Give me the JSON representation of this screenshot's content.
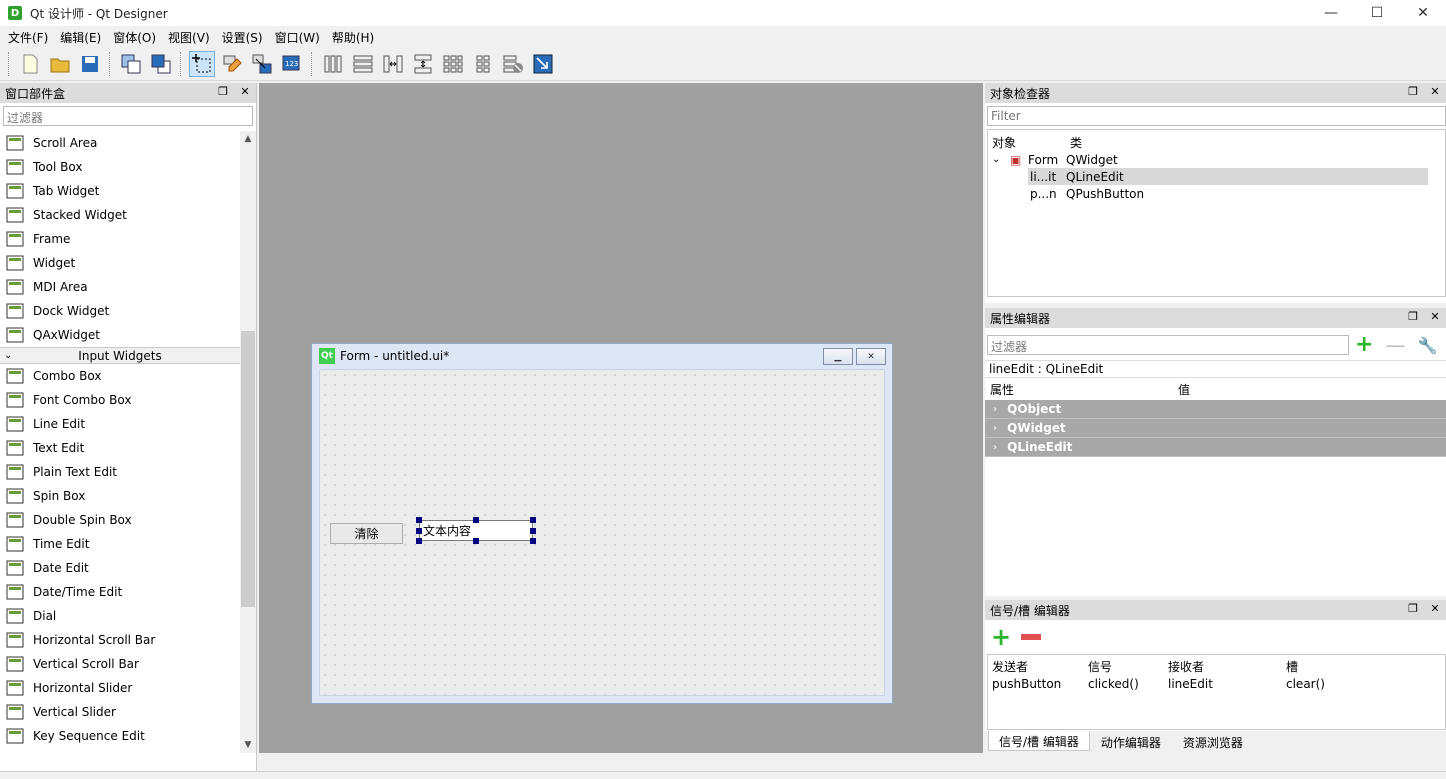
{
  "window": {
    "title": "Qt 设计师 - Qt Designer",
    "icon_letter": "D",
    "minimize": "—",
    "maximize": "☐",
    "close": "✕"
  },
  "menubar": [
    "文件(F)",
    "编辑(E)",
    "窗体(O)",
    "视图(V)",
    "设置(S)",
    "窗口(W)",
    "帮助(H)"
  ],
  "widgetbox": {
    "title": "窗口部件盒",
    "filter_placeholder": "过滤器",
    "items_top": [
      {
        "label": "Scroll Area",
        "icon": "scroll-area-icon"
      },
      {
        "label": "Tool Box",
        "icon": "tool-box-icon"
      },
      {
        "label": "Tab Widget",
        "icon": "tab-widget-icon"
      },
      {
        "label": "Stacked Widget",
        "icon": "stacked-widget-icon"
      },
      {
        "label": "Frame",
        "icon": "frame-icon"
      },
      {
        "label": "Widget",
        "icon": "widget-icon"
      },
      {
        "label": "MDI Area",
        "icon": "mdi-area-icon"
      },
      {
        "label": "Dock Widget",
        "icon": "dock-widget-icon"
      },
      {
        "label": "QAxWidget",
        "icon": "qaxwidget-icon"
      }
    ],
    "category": "Input Widgets",
    "items_input": [
      {
        "label": "Combo Box",
        "icon": "combo-box-icon"
      },
      {
        "label": "Font Combo Box",
        "icon": "font-combo-box-icon"
      },
      {
        "label": "Line Edit",
        "icon": "line-edit-icon"
      },
      {
        "label": "Text Edit",
        "icon": "text-edit-icon"
      },
      {
        "label": "Plain Text Edit",
        "icon": "plain-text-edit-icon"
      },
      {
        "label": "Spin Box",
        "icon": "spin-box-icon"
      },
      {
        "label": "Double Spin Box",
        "icon": "double-spin-box-icon"
      },
      {
        "label": "Time Edit",
        "icon": "time-edit-icon"
      },
      {
        "label": "Date Edit",
        "icon": "date-edit-icon"
      },
      {
        "label": "Date/Time Edit",
        "icon": "date-time-edit-icon"
      },
      {
        "label": "Dial",
        "icon": "dial-icon"
      },
      {
        "label": "Horizontal Scroll Bar",
        "icon": "horizontal-scroll-bar-icon"
      },
      {
        "label": "Vertical Scroll Bar",
        "icon": "vertical-scroll-bar-icon"
      },
      {
        "label": "Horizontal Slider",
        "icon": "horizontal-slider-icon"
      },
      {
        "label": "Vertical Slider",
        "icon": "vertical-slider-icon"
      },
      {
        "label": "Key Sequence Edit",
        "icon": "key-sequence-edit-icon"
      }
    ]
  },
  "form": {
    "title": "Form - untitled.ui*",
    "logo": "Qt",
    "button_label": "清除",
    "line_edit_text": "文本内容"
  },
  "object_inspector": {
    "title": "对象检查器",
    "filter_placeholder": "Filter",
    "col_object": "对象",
    "col_class": "类",
    "rows": [
      {
        "object": "Form",
        "class": "QWidget"
      },
      {
        "object": "li...it",
        "class": "QLineEdit"
      },
      {
        "object": "p...n",
        "class": "QPushButton"
      }
    ]
  },
  "property_editor": {
    "title": "属性编辑器",
    "filter_placeholder": "过滤器",
    "current": "lineEdit : QLineEdit",
    "col_property": "属性",
    "col_value": "值",
    "categories": [
      "QObject",
      "QWidget",
      "QLineEdit"
    ]
  },
  "signal_editor": {
    "title": "信号/槽 编辑器",
    "cols": [
      "发送者",
      "信号",
      "接收者",
      "槽"
    ],
    "row": [
      "pushButton",
      "clicked()",
      "lineEdit",
      "clear()"
    ]
  },
  "bottom_tabs": [
    "信号/槽 编辑器",
    "动作编辑器",
    "资源浏览器"
  ]
}
